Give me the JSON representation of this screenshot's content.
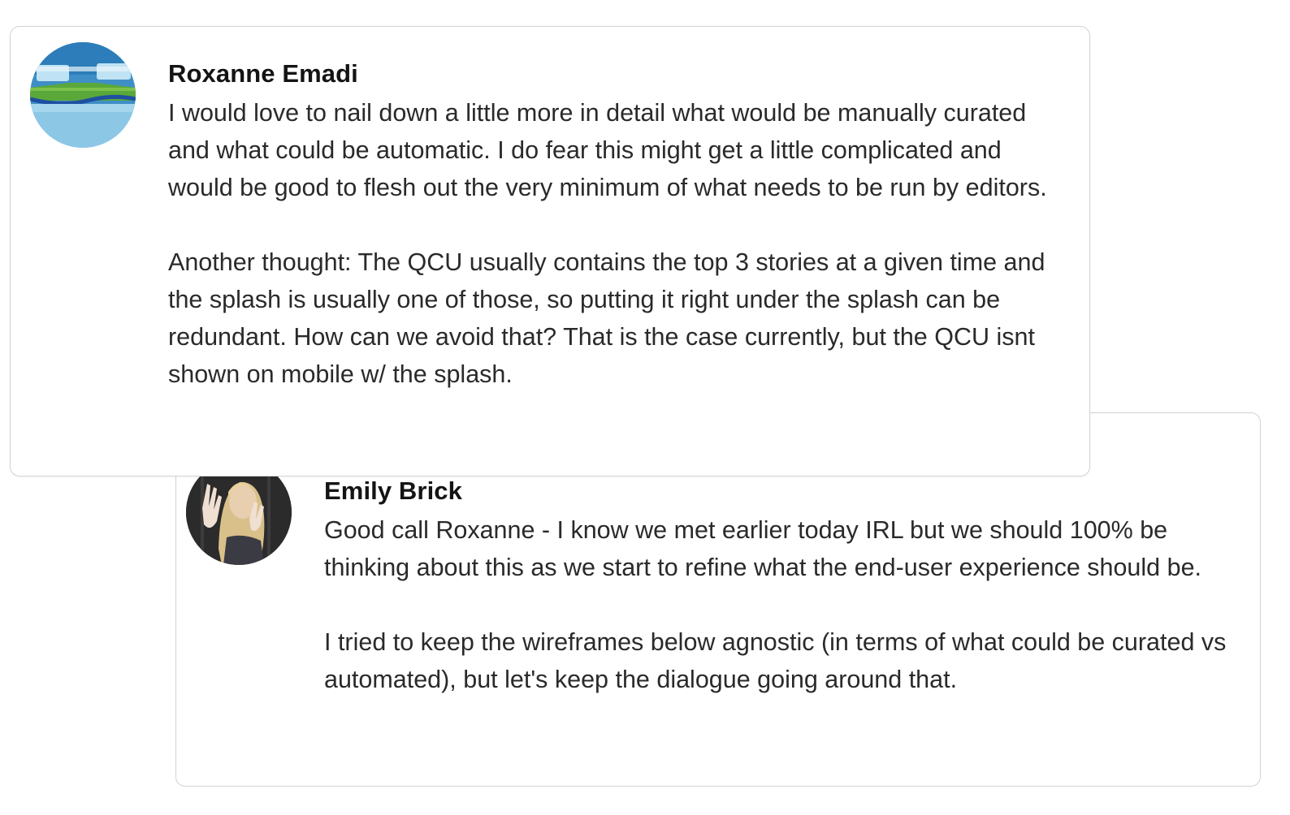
{
  "comments": [
    {
      "author": "Roxanne Emadi",
      "avatar_icon": "landscape-avatar",
      "paragraphs": [
        "I would love to nail down a little more in detail what would be manually curated and what could be automatic. I do fear this might get a little complicated and would be good to flesh out the very minimum of what needs to be run by editors.",
        "Another thought: The QCU usually contains the top 3 stories at a given time and the splash is usually one of those, so putting it right under the splash can be redundant. How can we avoid that? That is the case currently, but the QCU isnt shown on mobile w/ the splash."
      ]
    },
    {
      "author": "Emily Brick",
      "avatar_icon": "person-photo-avatar",
      "paragraphs": [
        "Good call Roxanne - I know we met earlier today IRL but we should 100% be thinking about this as we start to refine what the end-user experience should be.",
        "I tried to keep the wireframes below agnostic (in terms of what could be curated vs automated), but let's keep the dialogue going around that."
      ]
    }
  ],
  "colors": {
    "card_border": "#d2d2d2",
    "author_text": "#141414",
    "body_text": "#2a2a2a"
  }
}
